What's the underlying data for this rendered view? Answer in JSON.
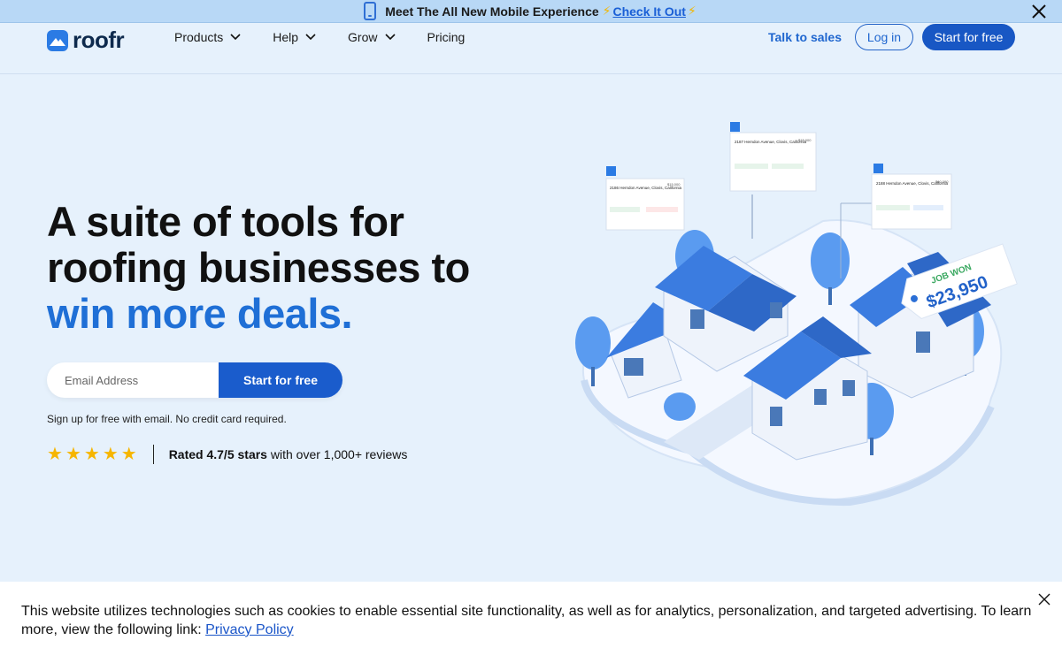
{
  "banner": {
    "message": "Meet The All New Mobile Experience",
    "link": "Check It Out"
  },
  "nav": {
    "brand": "roofr",
    "menu": [
      {
        "label": "Products",
        "dropdown": true
      },
      {
        "label": "Help",
        "dropdown": true
      },
      {
        "label": "Grow",
        "dropdown": true
      },
      {
        "label": "Pricing",
        "dropdown": false
      }
    ],
    "talk": "Talk to sales",
    "login": "Log in",
    "start": "Start for free"
  },
  "hero": {
    "line1": "A suite of tools for",
    "line2": "roofing businesses to",
    "line3": "win more deals.",
    "email_placeholder": "Email Address",
    "cta": "Start for free",
    "note": "Sign up for free with email. No credit card required.",
    "stars": 5,
    "rating_bold": "Rated 4.7/5 stars",
    "rating_rest": " with over 1,000+ reviews"
  },
  "cards": [
    {
      "address": "2186 Herndon Avenue, Clovis, California",
      "price": "$15,000"
    },
    {
      "address": "2187 Herndon Avenue, Clovis, California",
      "price": "$15,000"
    },
    {
      "address": "2188 Herndon Avenue, Clovis, California",
      "price": "$60,000"
    }
  ],
  "job_won": {
    "label": "JOB WON",
    "amount": "$23,950"
  },
  "cookie": {
    "text": "This website utilizes technologies such as cookies to enable essential site functionality, as well as for analytics, personalization, and targeted advertising. To learn more, view the following link: ",
    "link": "Privacy Policy"
  },
  "colors": {
    "brand": "#1857c4",
    "accent": "#1f6fd6",
    "background": "#e6f1fc",
    "star": "#f6b500"
  },
  "icons": [
    "phone-icon",
    "bolt-icon",
    "close-icon",
    "chevron-down-icon",
    "roofr-logo-icon",
    "star-icon"
  ]
}
